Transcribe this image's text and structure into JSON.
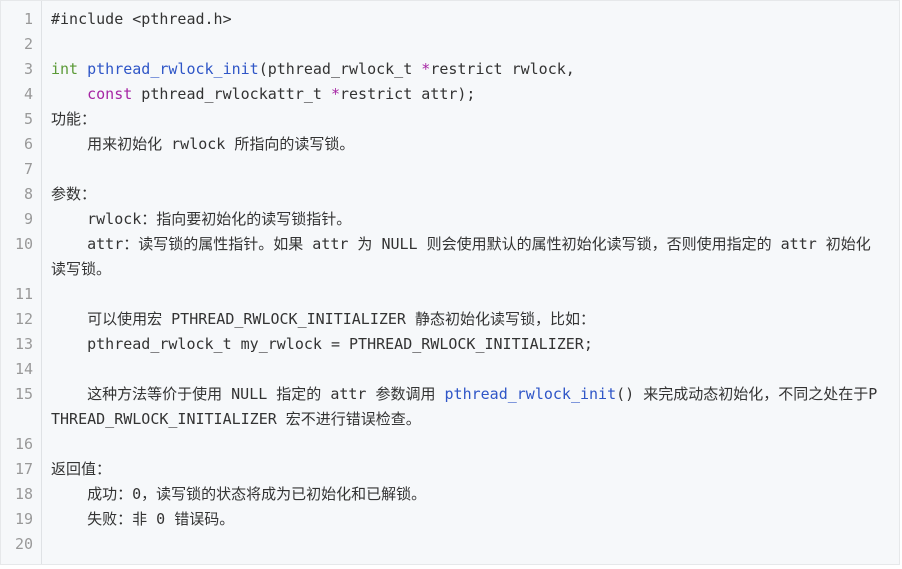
{
  "lines": [
    {
      "n": "1",
      "parts": [
        {
          "t": "#include <pthread.h>",
          "c": "plain"
        }
      ]
    },
    {
      "n": "2",
      "parts": [
        {
          "t": "",
          "c": "plain"
        }
      ]
    },
    {
      "n": "3",
      "parts": [
        {
          "t": "int",
          "c": "kw"
        },
        {
          "t": " ",
          "c": "plain"
        },
        {
          "t": "pthread_rwlock_init",
          "c": "fn"
        },
        {
          "t": "(pthread_rwlock_t ",
          "c": "plain"
        },
        {
          "t": "*",
          "c": "op"
        },
        {
          "t": "restrict rwlock,",
          "c": "plain"
        }
      ]
    },
    {
      "n": "4",
      "parts": [
        {
          "t": "    ",
          "c": "plain"
        },
        {
          "t": "const",
          "c": "kw2"
        },
        {
          "t": " pthread_rwlockattr_t ",
          "c": "plain"
        },
        {
          "t": "*",
          "c": "op"
        },
        {
          "t": "restrict attr);",
          "c": "plain"
        }
      ]
    },
    {
      "n": "5",
      "parts": [
        {
          "t": "功能：",
          "c": "plain"
        }
      ]
    },
    {
      "n": "6",
      "parts": [
        {
          "t": "    用来初始化 rwlock 所指向的读写锁。",
          "c": "plain"
        }
      ]
    },
    {
      "n": "7",
      "parts": [
        {
          "t": "",
          "c": "plain"
        }
      ]
    },
    {
      "n": "8",
      "parts": [
        {
          "t": "参数：",
          "c": "plain"
        }
      ]
    },
    {
      "n": "9",
      "parts": [
        {
          "t": "    rwlock：指向要初始化的读写锁指针。",
          "c": "plain"
        }
      ]
    },
    {
      "n": "10",
      "parts": [
        {
          "t": "    attr：读写锁的属性指针。如果 attr 为 NULL 则会使用默认的属性初始化读写锁，否则使用指定的 attr 初始化读写锁。",
          "c": "plain"
        }
      ]
    },
    {
      "n": "11",
      "parts": [
        {
          "t": "",
          "c": "plain"
        }
      ]
    },
    {
      "n": "12",
      "parts": [
        {
          "t": "    可以使用宏 PTHREAD_RWLOCK_INITIALIZER 静态初始化读写锁，比如：",
          "c": "plain"
        }
      ]
    },
    {
      "n": "13",
      "parts": [
        {
          "t": "    pthread_rwlock_t my_rwlock = PTHREAD_RWLOCK_INITIALIZER;",
          "c": "plain"
        }
      ]
    },
    {
      "n": "14",
      "parts": [
        {
          "t": "",
          "c": "plain"
        }
      ]
    },
    {
      "n": "15",
      "parts": [
        {
          "t": "    这种方法等价于使用 NULL 指定的 attr 参数调用 ",
          "c": "plain"
        },
        {
          "t": "pthread_rwlock_init",
          "c": "fn"
        },
        {
          "t": "() 来完成动态初始化，不同之处在于PTHREAD_RWLOCK_INITIALIZER 宏不进行错误检查。",
          "c": "plain"
        }
      ]
    },
    {
      "n": "16",
      "parts": [
        {
          "t": "",
          "c": "plain"
        }
      ]
    },
    {
      "n": "17",
      "parts": [
        {
          "t": "返回值：",
          "c": "plain"
        }
      ]
    },
    {
      "n": "18",
      "parts": [
        {
          "t": "    成功：0，读写锁的状态将成为已初始化和已解锁。",
          "c": "plain"
        }
      ]
    },
    {
      "n": "19",
      "parts": [
        {
          "t": "    失败：非 0 错误码。",
          "c": "plain"
        }
      ]
    },
    {
      "n": "20",
      "parts": [
        {
          "t": "",
          "c": "plain"
        }
      ]
    }
  ],
  "colors": {
    "background": "#f6f8fa",
    "line_number": "#999999",
    "keyword_int": "#5b9a37",
    "keyword_const": "#a626a4",
    "function": "#2f56c7",
    "text": "#333333"
  }
}
